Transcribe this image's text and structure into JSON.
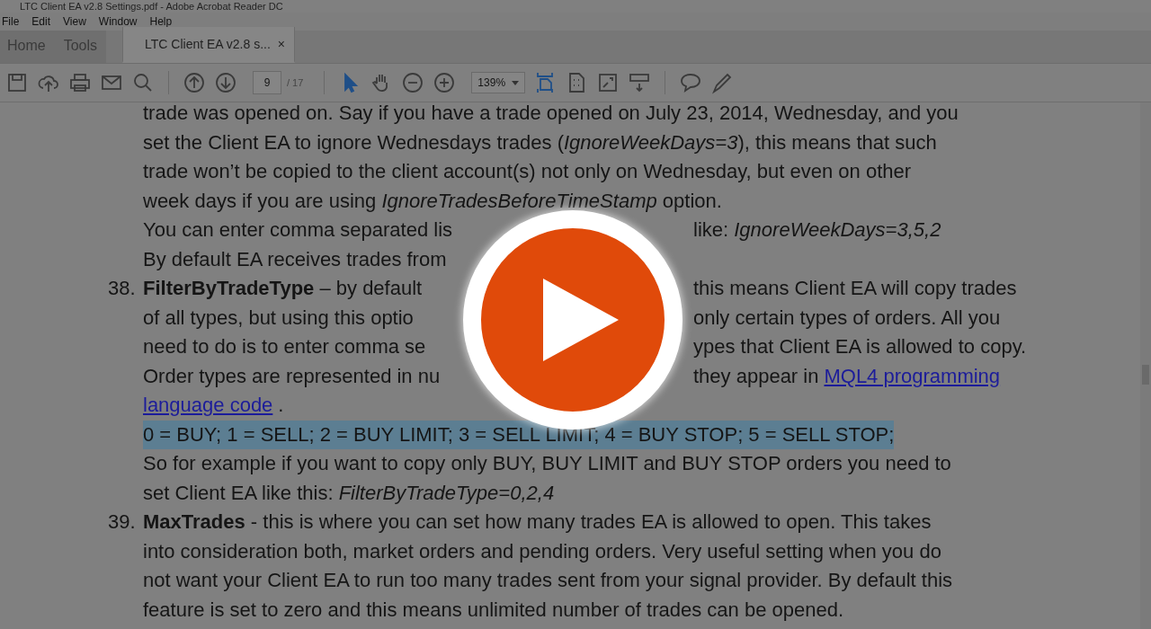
{
  "window": {
    "title": "LTC Client EA v2.8 Settings.pdf - Adobe Acrobat Reader DC"
  },
  "menu": [
    "File",
    "Edit",
    "View",
    "Window",
    "Help"
  ],
  "tabs": [
    {
      "label": "Home",
      "selected": false
    },
    {
      "label": "Tools",
      "selected": false
    },
    {
      "label": "LTC Client EA v2.8 s...",
      "selected": true,
      "close": "×"
    }
  ],
  "toolbar": [
    {
      "kind": "save",
      "selected": false
    },
    {
      "kind": "upload",
      "selected": false
    },
    {
      "kind": "print",
      "selected": false
    },
    {
      "kind": "mail",
      "selected": false
    },
    {
      "kind": "search",
      "selected": false
    },
    {
      "kind": "separator"
    },
    {
      "kind": "prev",
      "selected": false
    },
    {
      "kind": "next",
      "selected": false
    },
    {
      "kind": "page",
      "value": "9",
      "total": "/ 17"
    },
    {
      "kind": "separator"
    },
    {
      "kind": "select",
      "selected": true
    },
    {
      "kind": "hand",
      "selected": false
    },
    {
      "kind": "zoomout",
      "selected": false
    },
    {
      "kind": "zoomin",
      "selected": false
    },
    {
      "kind": "zoom",
      "value": "139%"
    },
    {
      "kind": "fit",
      "selected": true
    },
    {
      "kind": "pages",
      "selected": false
    },
    {
      "kind": "fullscreen",
      "selected": false
    },
    {
      "kind": "keyboard",
      "selected": false
    },
    {
      "kind": "separator"
    },
    {
      "kind": "comment",
      "selected": false
    },
    {
      "kind": "pen",
      "selected": false
    }
  ],
  "document": [
    {
      "lines": [
        {
          "highlight": false,
          "left": [
            {
              "text": "trade was opened on. Say if you have a trade opened on July 23, 2014, Wednesday, and you",
              "link": false
            }
          ]
        },
        {
          "highlight": false,
          "left": [
            {
              "text": "set the Client EA to ignore Wednesdays trades (*IgnoreWeekDays=3*), this means that such",
              "link": false
            }
          ]
        },
        {
          "highlight": false,
          "left": [
            {
              "text": "trade won’t be copied to the client account(s) not only on Wednesday, but even on other",
              "link": false
            }
          ]
        },
        {
          "highlight": false,
          "left": [
            {
              "text": "week days if you are using *IgnoreTradesBeforeTimeStamp* option.",
              "link": false
            }
          ]
        },
        {
          "highlight": false,
          "left": [
            {
              "text": "You can enter comma separated lis",
              "link": false
            }
          ],
          "right": [
            {
              "text": "like: *IgnoreWeekDays=3,5,2*",
              "link": false
            }
          ]
        },
        {
          "highlight": false,
          "left": [
            {
              "text": "By default EA receives trades from",
              "link": false
            }
          ]
        }
      ]
    },
    {
      "number": "38.",
      "lines": [
        {
          "highlight": false,
          "left": [
            {
              "text": "**FilterByTradeType** – by default",
              "link": false
            }
          ],
          "right": [
            {
              "text": "this means Client EA will copy trades",
              "link": false
            }
          ]
        },
        {
          "highlight": false,
          "left": [
            {
              "text": "of all types, but using this optio",
              "link": false
            }
          ],
          "right": [
            {
              "text": "only certain types of orders. All you",
              "link": false
            }
          ]
        },
        {
          "highlight": false,
          "left": [
            {
              "text": "need to do is to enter comma se",
              "link": false
            }
          ],
          "right": [
            {
              "text": "ypes that Client EA is allowed to copy.",
              "link": false
            }
          ]
        },
        {
          "highlight": false,
          "left": [
            {
              "text": "Order types are represented in nu",
              "link": false
            }
          ],
          "right": [
            {
              "text": "they appear in",
              "link": false
            },
            {
              "text": "MQL4 programming",
              "link": true
            }
          ]
        },
        {
          "highlight": false,
          "left": [
            {
              "text": "language code",
              "link": true
            },
            {
              "text": ".",
              "link": false
            }
          ]
        },
        {
          "highlight": true,
          "left": [
            {
              "text": "0 = BUY; 1 = SELL; 2 = BUY LIMIT; 3 = SELL LIMIT; 4 = BUY STOP; 5 = SELL STOP;",
              "link": false
            }
          ]
        },
        {
          "highlight": false,
          "left": [
            {
              "text": "So for example if you want to copy only BUY, BUY LIMIT and BUY STOP orders you need to",
              "link": false
            }
          ]
        },
        {
          "highlight": false,
          "left": [
            {
              "text": "set Client EA like this: *FilterByTradeType=0,2,4*",
              "link": false
            }
          ]
        }
      ]
    },
    {
      "number": "39.",
      "lines": [
        {
          "highlight": false,
          "left": [
            {
              "text": "**MaxTrades** - this is where you can set how many trades EA is allowed to open. This takes",
              "link": false
            }
          ]
        },
        {
          "highlight": false,
          "left": [
            {
              "text": "into consideration both, market orders and pending orders. Very useful setting when you do",
              "link": false
            }
          ]
        },
        {
          "highlight": false,
          "left": [
            {
              "text": "not want your Client EA to run too many trades sent from your signal provider. By default this",
              "link": false
            }
          ]
        },
        {
          "highlight": false,
          "left": [
            {
              "text": "feature is set to zero and this means unlimited number of trades can be opened.",
              "link": false
            }
          ]
        }
      ]
    }
  ]
}
